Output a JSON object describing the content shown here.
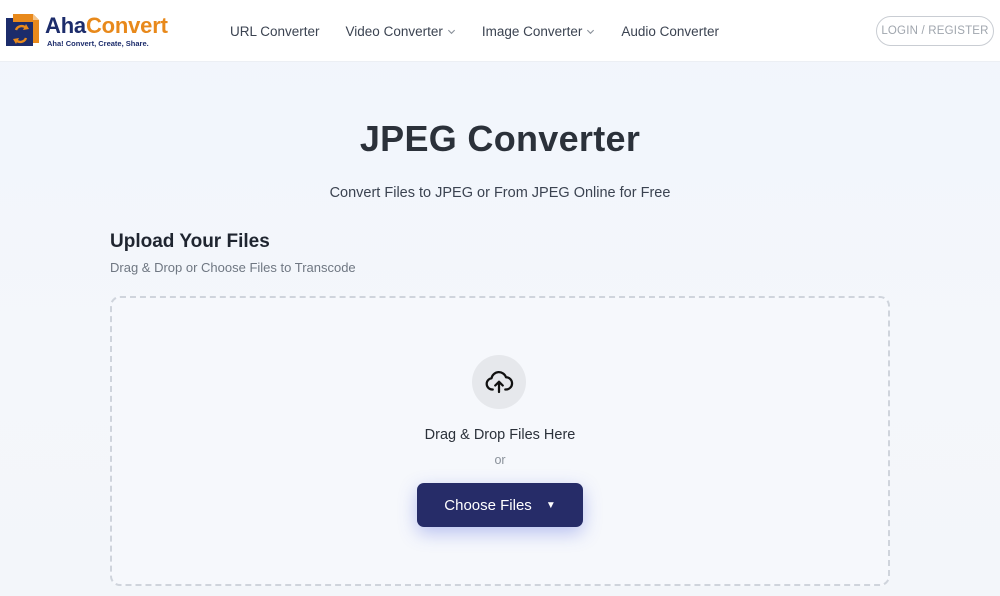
{
  "brand": {
    "name_part1": "Aha",
    "name_part2": "Convert",
    "tagline": "Aha! Convert, Create, Share.",
    "colors": {
      "navy": "#1c2c6b",
      "orange": "#e8891b"
    }
  },
  "nav": {
    "items": [
      {
        "label": "URL Converter",
        "has_dropdown": false
      },
      {
        "label": "Video Converter",
        "has_dropdown": true
      },
      {
        "label": "Image Converter",
        "has_dropdown": true
      },
      {
        "label": "Audio Converter",
        "has_dropdown": false
      }
    ],
    "login_label": "LOGIN / REGISTER"
  },
  "hero": {
    "title": "JPEG Converter",
    "subtitle": "Convert Files to JPEG or From JPEG Online for Free"
  },
  "upload": {
    "heading": "Upload Your Files",
    "subheading": "Drag & Drop or Choose Files to Transcode",
    "icon": "cloud-upload-icon",
    "drop_text": "Drag & Drop Files Here",
    "or_text": "or",
    "choose_label": "Choose Files",
    "button_color": "#262c68"
  }
}
